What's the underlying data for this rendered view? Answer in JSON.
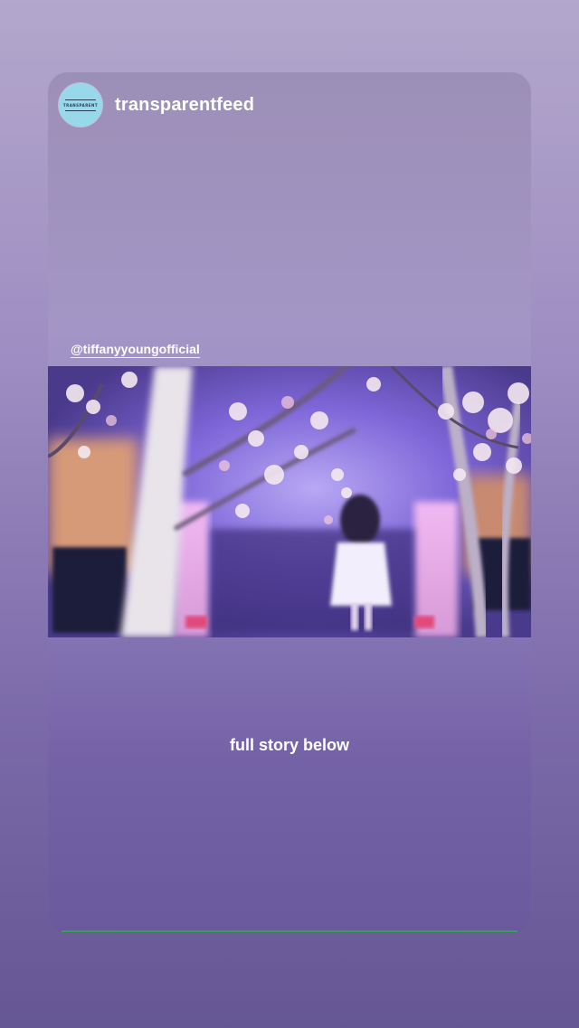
{
  "story": {
    "username": "transparentfeed",
    "avatar_logo_text": "TRANSPARENT",
    "mention": "@tiffanyyoungofficial",
    "caption": "full story below",
    "media": {
      "type": "video",
      "icon": "video-frame"
    },
    "colors": {
      "avatar_bg": "#97d8ea",
      "progress": "#2fa44f",
      "text": "#ffffff"
    }
  }
}
